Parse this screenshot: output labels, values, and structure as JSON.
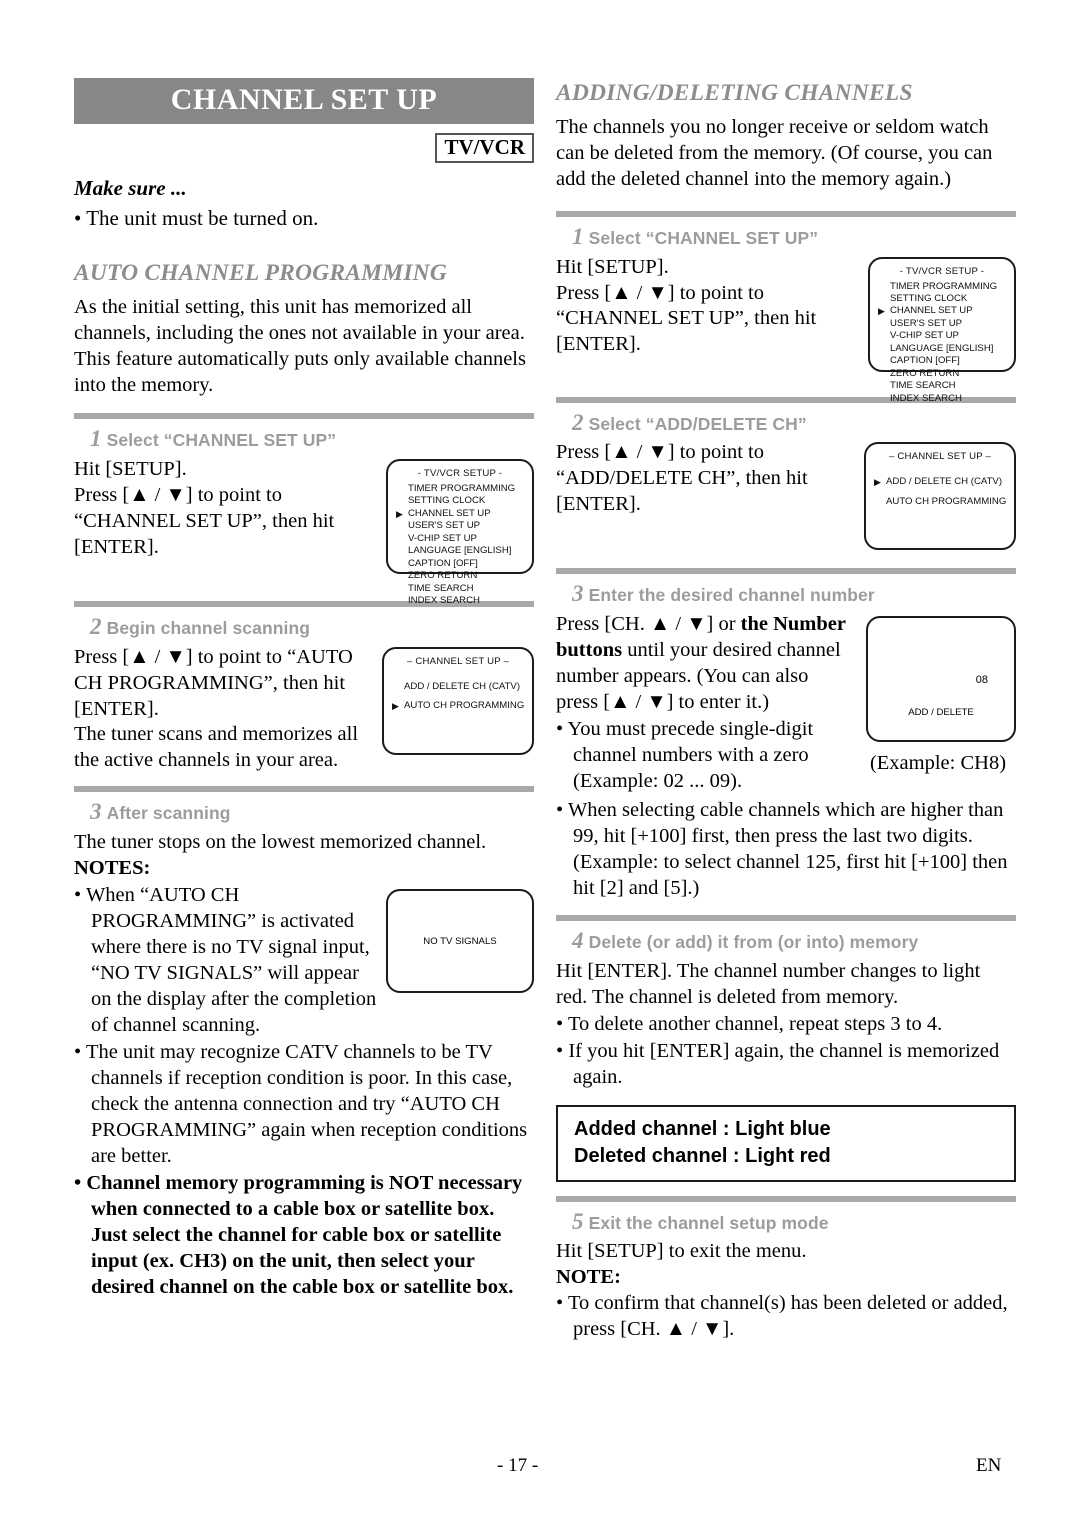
{
  "page": {
    "title": "CHANNEL SET UP",
    "badge": "TV/VCR",
    "footer_page": "- 17 -",
    "footer_lang": "EN",
    "colors": {
      "title_bar": "#878787",
      "rule": "#a9a9a9",
      "step_head": "#9c9c9c",
      "section_head": "#8d8d8d"
    }
  },
  "left": {
    "make_sure_label": "Make sure ...",
    "make_sure_item": "• The unit must be turned on.",
    "section_heading": "AUTO CHANNEL PROGRAMMING",
    "intro": "As the initial setting, this unit has memorized all channels, including the ones not available in your area. This feature automatically puts only available channels into the memory.",
    "step1": {
      "num": "1",
      "heading": "Select “CHANNEL SET UP”",
      "line1": "Hit [SETUP].",
      "line2": "Press [▲ / ▼] to point to “CHANNEL SET UP”, then hit [ENTER]."
    },
    "step2": {
      "num": "2",
      "heading": "Begin channel scanning",
      "line1": "Press [▲ / ▼] to point to “AUTO CH PROGRAMMING”, then hit [ENTER].",
      "line2": "The tuner scans and memorizes all the active channels in your area."
    },
    "step3": {
      "num": "3",
      "heading": "After scanning",
      "line1": "The tuner stops on the lowest memorized channel.",
      "notes_label": "NOTES:",
      "note1": "When “AUTO CH PROGRAMMING” is activated where there is no TV signal input, “NO TV SIGNALS” will appear on the display after the completion of channel scanning.",
      "note2": "The unit may recognize CATV channels to be TV channels if reception condition is poor. In this case, check the antenna connection and try “AUTO CH PROGRAMMING” again when reception conditions are better.",
      "note3": "Channel memory programming is NOT necessary when connected to a cable box or satellite box. Just select the channel for cable box or satellite input (ex. CH3) on the unit, then select your desired channel on the cable box or satellite box."
    }
  },
  "right": {
    "section_heading": "ADDING/DELETING CHANNELS",
    "intro": "The channels you no longer receive or seldom watch can be deleted from the memory. (Of course, you can add the deleted channel into the memory again.)",
    "step1": {
      "num": "1",
      "heading": "Select “CHANNEL SET UP”",
      "line1": "Hit [SETUP].",
      "line2": "Press [▲ / ▼] to point to “CHANNEL SET UP”, then hit [ENTER]."
    },
    "step2": {
      "num": "2",
      "heading": "Select “ADD/DELETE CH”",
      "line1": "Press [▲ / ▼] to point to “ADD/DELETE CH”, then hit [ENTER]."
    },
    "step3": {
      "num": "3",
      "heading": "Enter the desired channel number",
      "line1_a": "Press [CH. ▲ / ▼] or ",
      "line1_b": "the Number buttons",
      "line1_c": " until your desired channel number appears. (You can also press [▲ / ▼] to enter it.)",
      "note1": "You must precede single-digit channel numbers with a zero (Example: 02 ...  09).",
      "note2": "When selecting cable channels which are higher than 99, hit [+100] first, then press the last two digits. (Example: to select channel 125, first hit [+100] then hit [2] and [5].)",
      "example_caption": "(Example: CH8)"
    },
    "step4": {
      "num": "4",
      "heading": "Delete (or add) it from (or into) memory",
      "line1": "Hit [ENTER]. The channel number changes to light red. The channel is deleted from memory.",
      "note1": "To delete another channel, repeat steps 3 to 4.",
      "note2": "If you hit [ENTER] again, the channel is memorized again."
    },
    "callout": {
      "line1": "Added channel  : Light blue",
      "line2": "Deleted channel : Light red"
    },
    "step5": {
      "num": "5",
      "heading": "Exit the channel setup mode",
      "line1": "Hit [SETUP] to exit the menu.",
      "note_label": "NOTE:",
      "note1": "To confirm that channel(s) has been deleted or added, press [CH. ▲ / ▼]."
    }
  },
  "osd": {
    "tvvcr_setup": {
      "title": "- TV/VCR SETUP -",
      "items": [
        {
          "label": "TIMER PROGRAMMING",
          "selected": false
        },
        {
          "label": "SETTING CLOCK",
          "selected": false
        },
        {
          "label": "CHANNEL SET UP",
          "selected": true
        },
        {
          "label": "USER'S SET UP",
          "selected": false
        },
        {
          "label": "V-CHIP SET UP",
          "selected": false
        },
        {
          "label": "LANGUAGE  [ENGLISH]",
          "selected": false
        },
        {
          "label": "CAPTION  [OFF]",
          "selected": false
        },
        {
          "label": "ZERO RETURN",
          "selected": false
        },
        {
          "label": "TIME SEARCH",
          "selected": false
        },
        {
          "label": "INDEX SEARCH",
          "selected": false
        }
      ]
    },
    "channel_setup_auto": {
      "title": "– CHANNEL SET UP –",
      "items": [
        {
          "label": "ADD / DELETE CH (CATV)",
          "selected": false
        },
        {
          "label": "AUTO CH PROGRAMMING",
          "selected": true
        }
      ]
    },
    "channel_setup_add": {
      "title": "– CHANNEL SET UP –",
      "items": [
        {
          "label": "ADD / DELETE CH (CATV)",
          "selected": true
        },
        {
          "label": "AUTO CH PROGRAMMING",
          "selected": false
        }
      ]
    },
    "no_tv_signals": {
      "text": "NO TV SIGNALS"
    },
    "add_delete": {
      "channel": "08",
      "label": "ADD / DELETE"
    }
  }
}
